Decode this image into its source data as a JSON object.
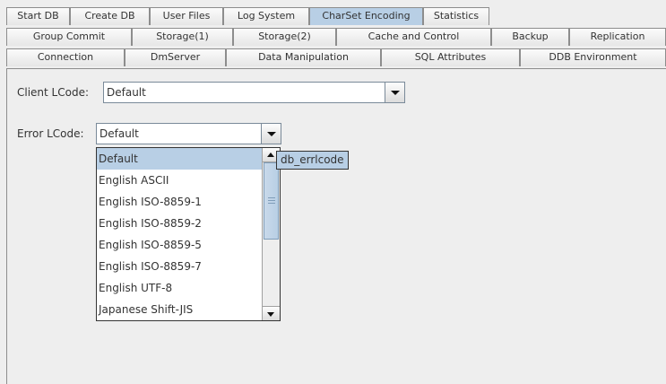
{
  "tabs": {
    "row1": [
      "Start DB",
      "Create DB",
      "User Files",
      "Log System",
      "CharSet Encoding",
      "Statistics"
    ],
    "row2": [
      "Group Commit",
      "Storage(1)",
      "Storage(2)",
      "Cache and Control",
      "Backup",
      "Replication"
    ],
    "row3": [
      "Connection",
      "DmServer",
      "Data Manipulation",
      "SQL Attributes",
      "DDB Environment"
    ],
    "selected": "CharSet Encoding"
  },
  "form": {
    "client_label": "Client LCode:",
    "client_value": "Default",
    "error_label": "Error LCode:",
    "error_value": "Default"
  },
  "dropdown": {
    "items": [
      "Default",
      "English ASCII",
      "English ISO-8859-1",
      "English ISO-8859-2",
      "English ISO-8859-5",
      "English ISO-8859-7",
      "English UTF-8",
      "Japanese Shift-JIS"
    ],
    "selected_index": 0
  },
  "tooltip": "db_errlcode",
  "colors": {
    "selected": "#b8cfe5",
    "background": "#eeeeee",
    "border": "#8d8d8d"
  }
}
